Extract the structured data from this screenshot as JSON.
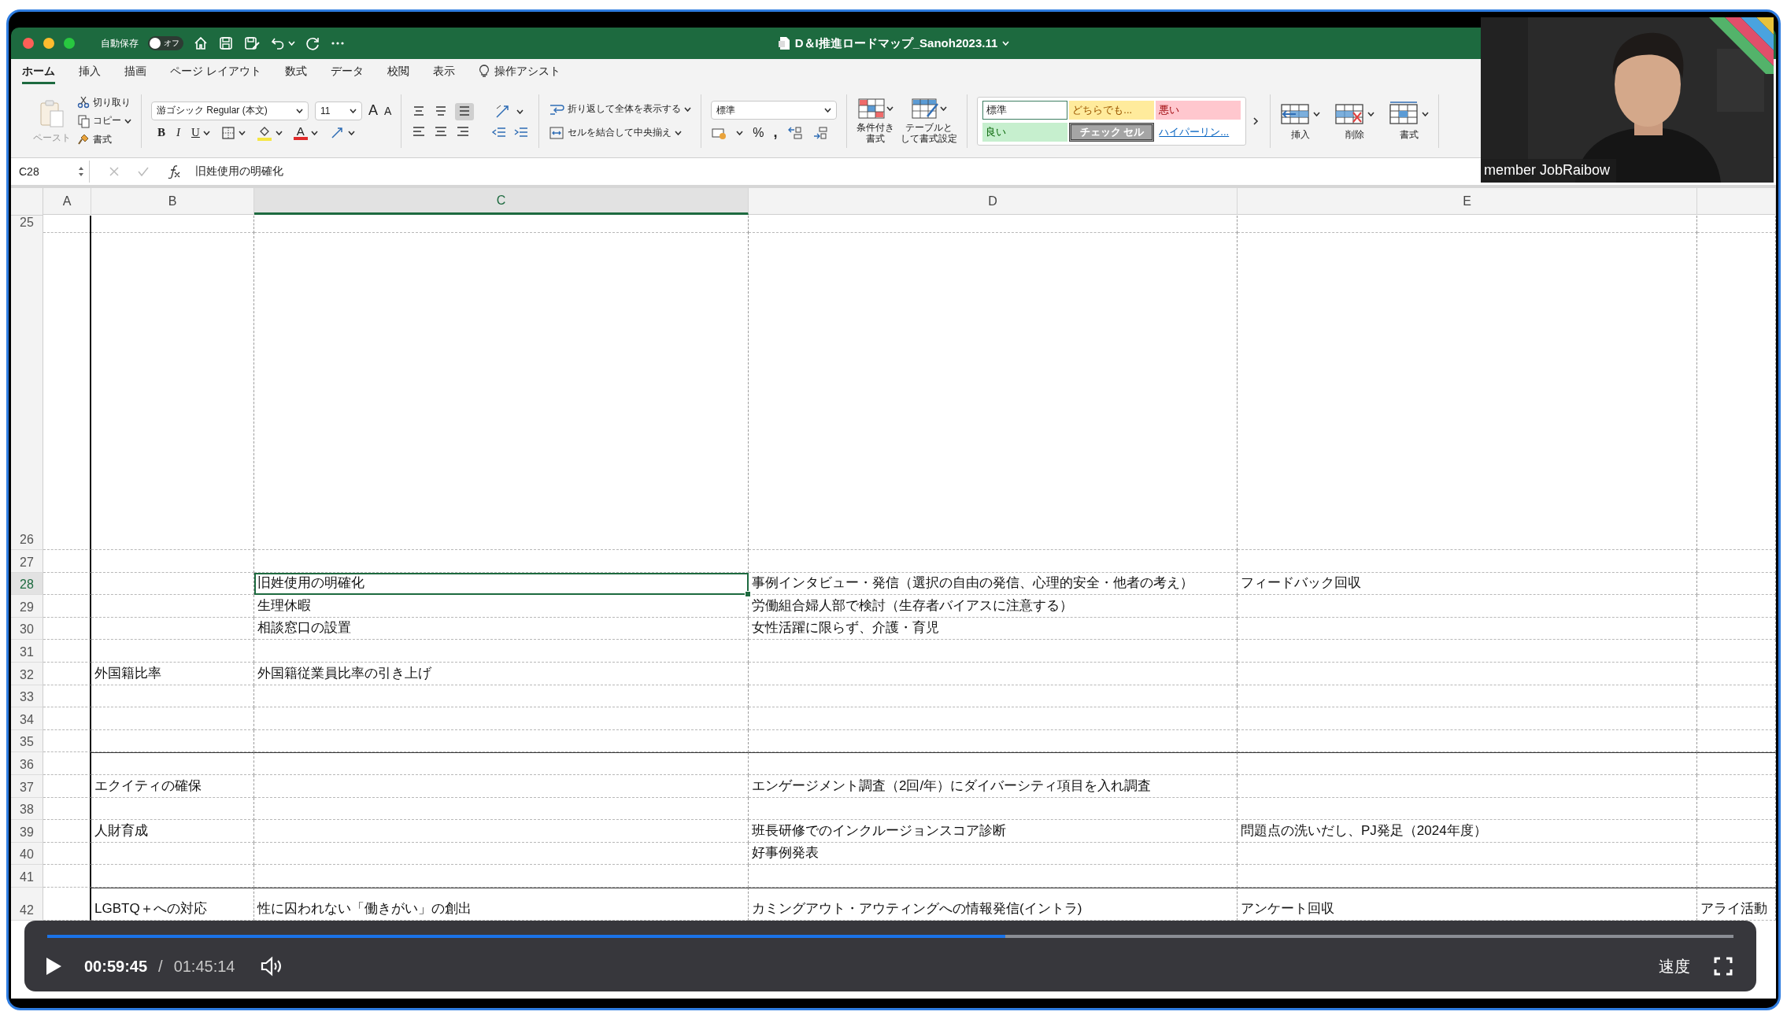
{
  "title_bar": {
    "autosave_label": "自動保存",
    "autosave": {
      "label": "オフ",
      "on": false
    },
    "document_title": "D＆I推進ロードマップ_Sanoh2023.11"
  },
  "ribbon_tabs": [
    {
      "label": "ホーム",
      "selected": true
    },
    {
      "label": "挿入",
      "selected": false
    },
    {
      "label": "描画",
      "selected": false
    },
    {
      "label": "ページ レイアウト",
      "selected": false
    },
    {
      "label": "数式",
      "selected": false
    },
    {
      "label": "データ",
      "selected": false
    },
    {
      "label": "校閲",
      "selected": false
    },
    {
      "label": "表示",
      "selected": false
    }
  ],
  "tell_me": "操作アシスト",
  "ribbon": {
    "paste": "ペースト",
    "cut": "切り取り",
    "copy": "コピー",
    "format_painter": "書式",
    "font_name": "游ゴシック Regular (本文)",
    "font_size": "11",
    "grow_font": "A",
    "shrink_font": "A",
    "bold": "B",
    "italic": "I",
    "underline": "U",
    "font_color": "A",
    "wrap_text": "折り返して全体を表示する",
    "merge_center": "セルを結合して中央揃え",
    "number_format": "標準",
    "percent": "%",
    "comma": ",",
    "conditional_format": [
      "条件付き",
      "書式"
    ],
    "format_as_table": [
      "テーブルと",
      "して書式設定"
    ],
    "cell_styles": [
      {
        "label": "標準",
        "kind": "normal"
      },
      {
        "label": "どちらでも...",
        "kind": "neutral"
      },
      {
        "label": "悪い",
        "kind": "bad"
      },
      {
        "label": "良い",
        "kind": "good"
      },
      {
        "label": "チェック セル",
        "kind": "check"
      },
      {
        "label": "ハイパーリン...",
        "kind": "link"
      }
    ],
    "insert": "挿入",
    "delete": "削除",
    "format": "書式"
  },
  "formula_bar": {
    "name_box": "C28",
    "formula": "旧姓使用の明確化"
  },
  "sheet": {
    "columns": [
      {
        "label": "A",
        "selected": false
      },
      {
        "label": "B",
        "selected": false
      },
      {
        "label": "C",
        "selected": true
      },
      {
        "label": "D",
        "selected": false
      },
      {
        "label": "E",
        "selected": false
      }
    ],
    "rows": [
      {
        "number": "25",
        "selected": false
      },
      {
        "number": "26",
        "selected": false
      },
      {
        "number": "27",
        "selected": false
      },
      {
        "number": "28",
        "selected": true,
        "C": "旧姓使用の明確化",
        "D": "事例インタビュー・発信（選択の自由の発信、心理的安全・他者の考え）",
        "E": "フィードバック回収"
      },
      {
        "number": "29",
        "selected": false,
        "C": "生理休暇",
        "D": "労働組合婦人部で検討（生存者バイアスに注意する）"
      },
      {
        "number": "30",
        "selected": false,
        "C": "相談窓口の設置",
        "D": "女性活躍に限らず、介護・育児"
      },
      {
        "number": "31",
        "selected": false
      },
      {
        "number": "32",
        "selected": false,
        "B": "外国籍比率",
        "C": "外国籍従業員比率の引き上げ"
      },
      {
        "number": "33",
        "selected": false
      },
      {
        "number": "34",
        "selected": false
      },
      {
        "number": "35",
        "selected": false
      },
      {
        "number": "36",
        "selected": false
      },
      {
        "number": "37",
        "selected": false,
        "B": "エクイティの確保",
        "D": "エンゲージメント調査（2回/年）にダイバーシティ項目を入れ調査"
      },
      {
        "number": "38",
        "selected": false
      },
      {
        "number": "39",
        "selected": false,
        "B": "人財育成",
        "D": "班長研修でのインクルージョンスコア診断",
        "E": "問題点の洗いだし、PJ発足（2024年度）"
      },
      {
        "number": "40",
        "selected": false,
        "D": "好事例発表"
      },
      {
        "number": "41",
        "selected": false
      },
      {
        "number": "42",
        "selected": false,
        "B": "LGBTQ＋への対応",
        "C": "性に囚われない「働きがい」の創出",
        "D": "カミングアウト・アウティングへの情報発信(イントラ)",
        "E": "アンケート回収",
        "F": "アライ活動"
      }
    ]
  },
  "player": {
    "playing": false,
    "progress": {
      "level": 0.568
    },
    "current_time": "00:59:45",
    "separator": "/",
    "total_time": "01:45:14",
    "speed": "速度"
  },
  "webcam": {
    "kind": "picture",
    "name_tag": "member JobRaibow"
  }
}
